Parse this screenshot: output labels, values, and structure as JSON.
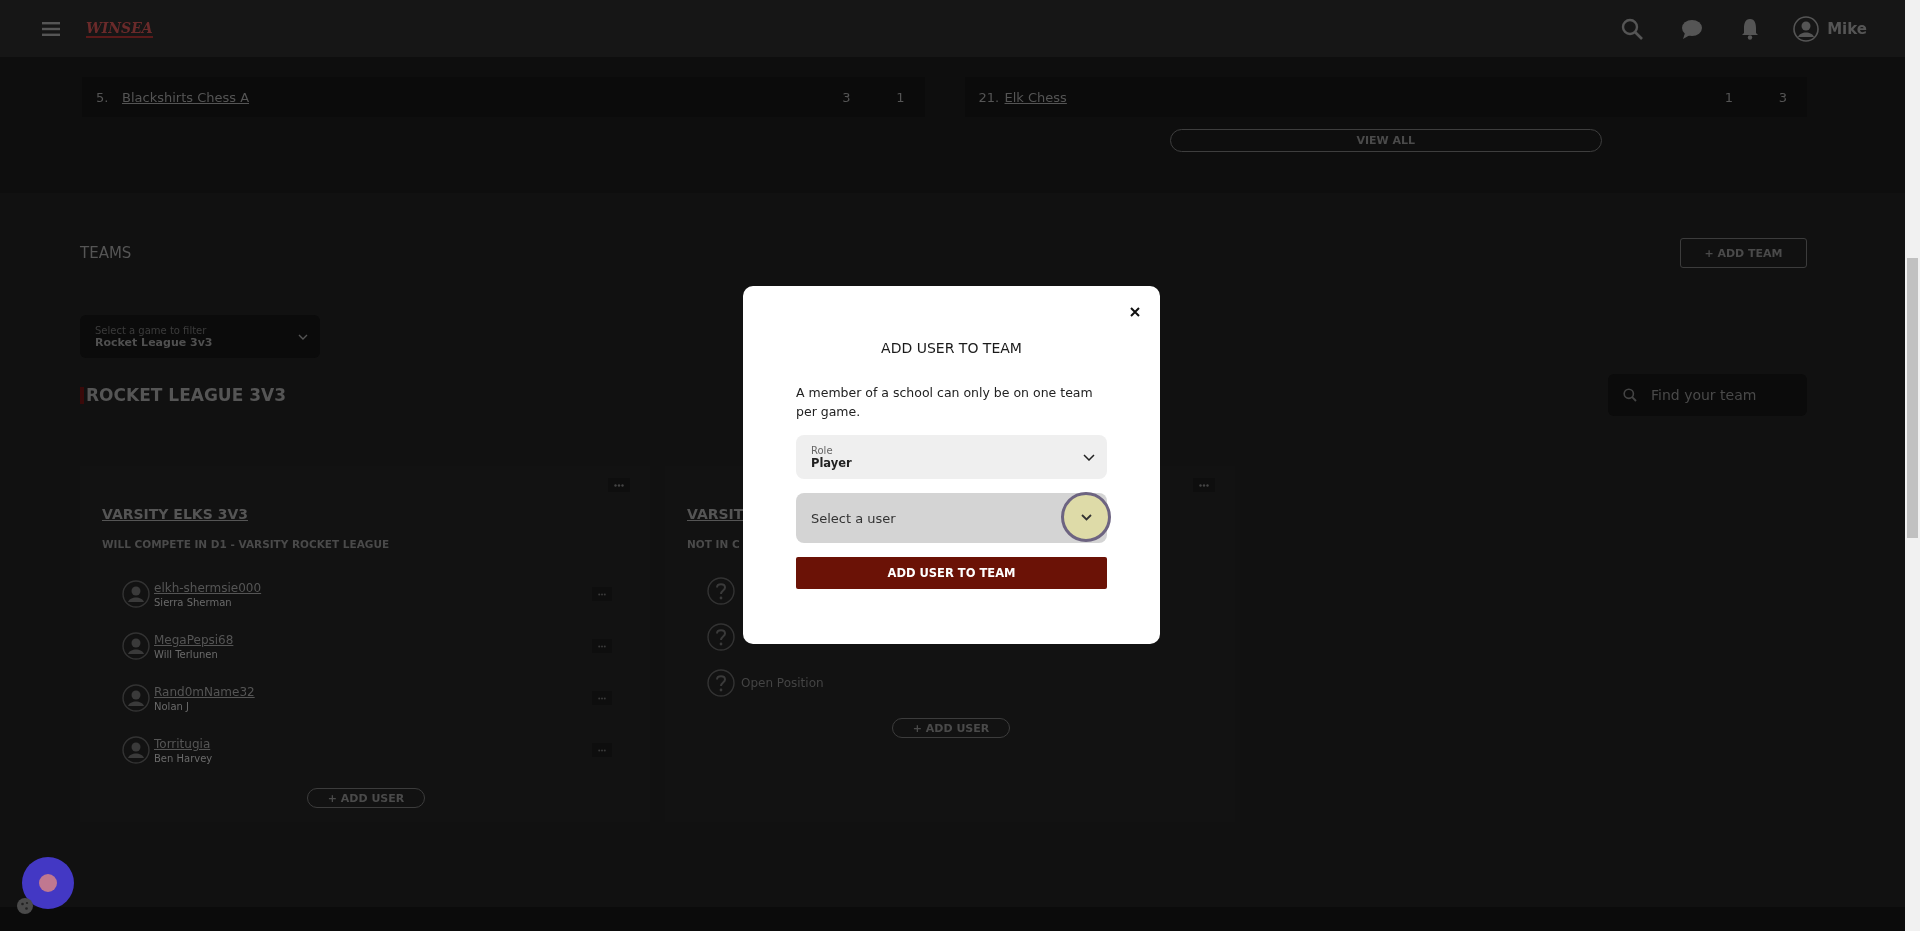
{
  "header": {
    "logo_text": "WINSEA",
    "user_name": "Mike"
  },
  "standings": {
    "tables": [
      {
        "rows": [
          {
            "rank": "5.",
            "team": "Blackshirts Chess A",
            "col_1": "3",
            "col_2": "1"
          }
        ]
      },
      {
        "rows": [
          {
            "rank": "21.",
            "team": "Elk Chess",
            "col_1": "1",
            "col_2": "3"
          }
        ]
      }
    ],
    "view_all": "VIEW ALL"
  },
  "teams": {
    "title": "TEAMS",
    "add_team": "+ ADD TEAM",
    "filter": {
      "label": "Select a game to filter",
      "value": "Rocket League 3v3"
    },
    "game_heading": "ROCKET LEAGUE 3V3",
    "search": {
      "placeholder": "Find your team"
    },
    "cards": [
      {
        "name": "VARSITY ELKS 3V3",
        "subtitle": "WILL COMPETE IN D1 - VARSITY ROCKET LEAGUE",
        "add_user": "+ ADD USER",
        "members": [
          {
            "kind": "user",
            "username": "elkh-shermsie000",
            "full_name": "Sierra Sherman"
          },
          {
            "kind": "user",
            "username": "MegaPepsi68",
            "full_name": "Will Terlunen"
          },
          {
            "kind": "user",
            "username": "Rand0mName32",
            "full_name": "Nolan J"
          },
          {
            "kind": "user",
            "username": "Torritugia",
            "full_name": "Ben Harvey"
          }
        ]
      },
      {
        "name": "VARSIT",
        "subtitle": "NOT IN C",
        "add_user": "+ ADD USER",
        "members": [
          {
            "kind": "open"
          },
          {
            "kind": "open"
          },
          {
            "kind": "open",
            "label": "Open Position"
          }
        ]
      }
    ]
  },
  "modal": {
    "title": "ADD USER TO TEAM",
    "description": "A member of a school can only be on one team per game.",
    "role": {
      "label": "Role",
      "value": "Player"
    },
    "user_select": {
      "placeholder": "Select a user"
    },
    "submit": "ADD USER TO TEAM"
  }
}
